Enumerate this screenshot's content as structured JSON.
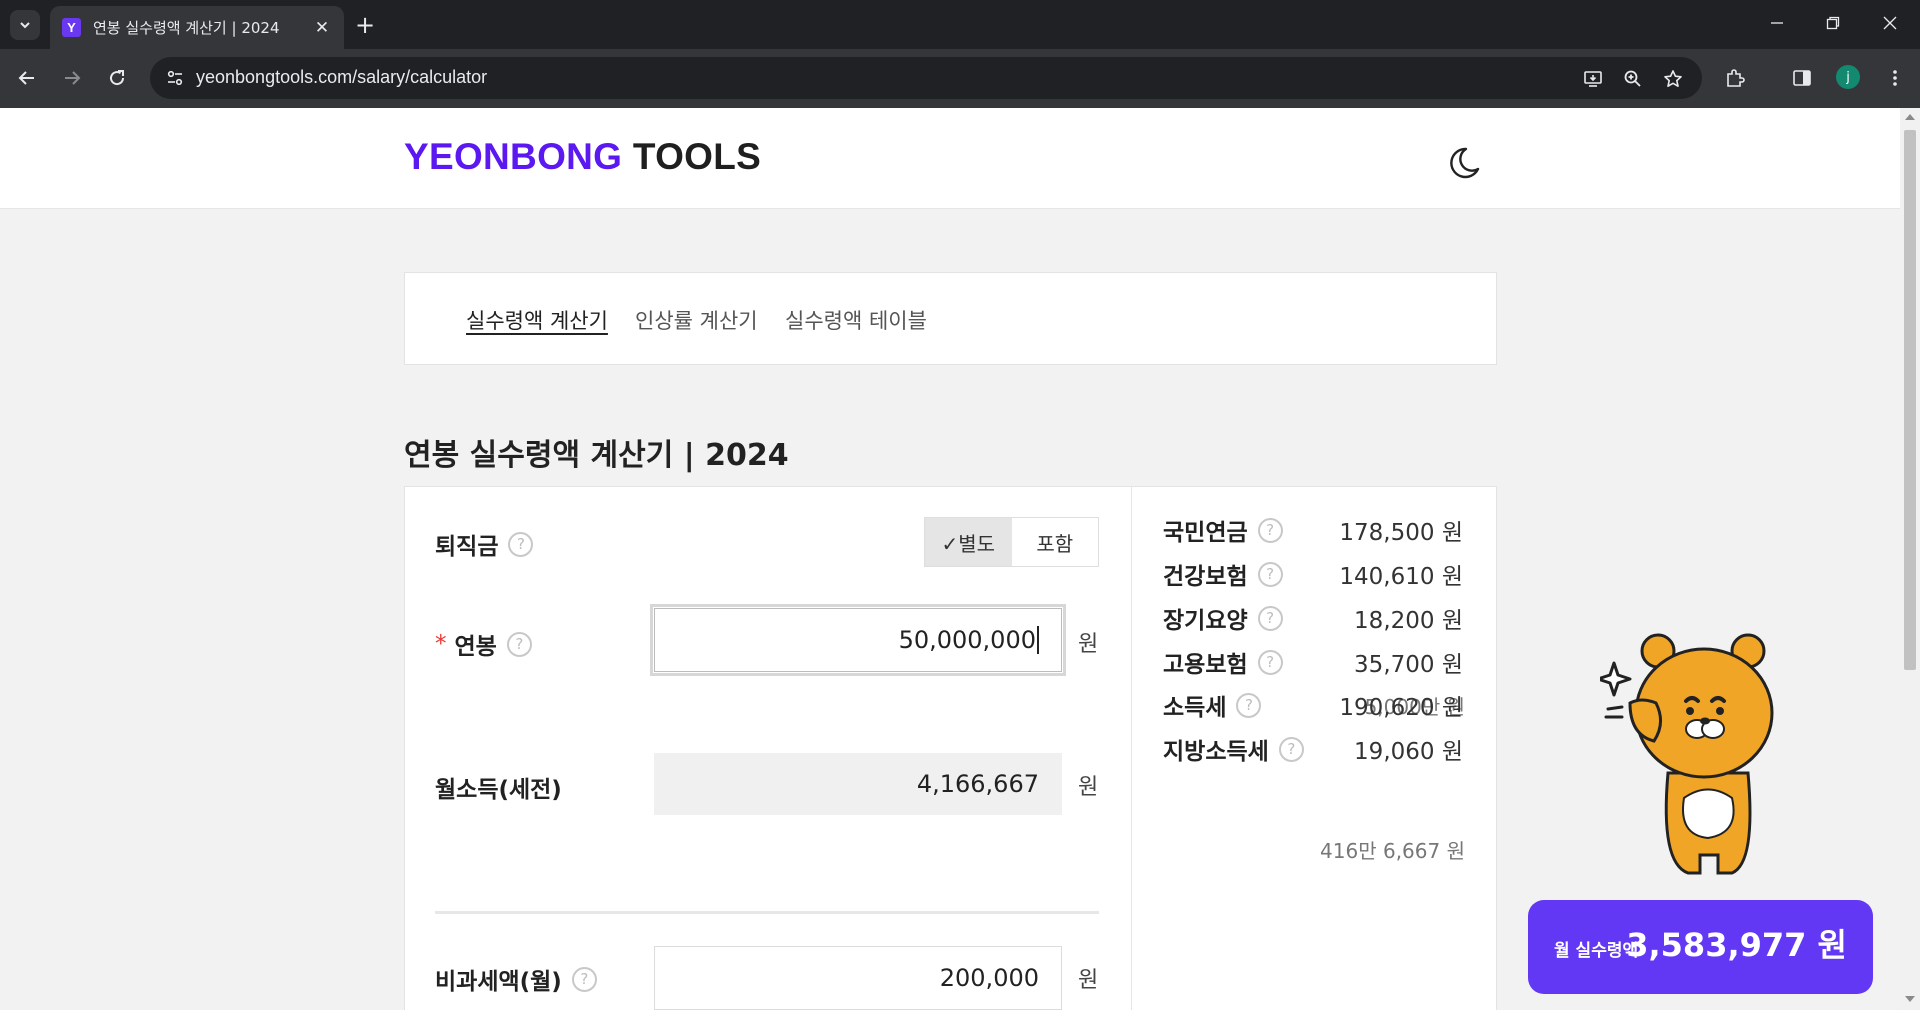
{
  "browser": {
    "tab_title": "연봉 실수령액 계산기 | 2024",
    "favicon_letter": "Y",
    "url": "yeonbongtools.com/salary/calculator",
    "profile_initial": "j"
  },
  "header": {
    "logo_brand": "YEONBONG",
    "logo_suffix": " TOOLS"
  },
  "subnav": {
    "items": [
      {
        "label": "실수령액 계산기",
        "active": true
      },
      {
        "label": "인상률 계산기",
        "active": false
      },
      {
        "label": "실수령액 테이블",
        "active": false
      }
    ]
  },
  "page_title": "연봉 실수령액 계산기 | 2024",
  "form": {
    "severance": {
      "label": "퇴직금",
      "options": [
        "✓별도",
        "포함"
      ],
      "selected": "✓별도"
    },
    "salary": {
      "required_mark": "*",
      "label": "연봉",
      "value": "50,000,000",
      "unit": "원",
      "hint": "5,000만 원"
    },
    "monthly": {
      "label": "월소득(세전)",
      "value": "4,166,667",
      "unit": "원",
      "hint": "416만 6,667 원"
    },
    "nontax": {
      "label": "비과세액(월)",
      "value": "200,000",
      "unit": "원"
    }
  },
  "deductions": [
    {
      "label": "국민연금",
      "value": "178,500 원"
    },
    {
      "label": "건강보험",
      "value": "140,610 원"
    },
    {
      "label": "장기요양",
      "value": "18,200 원"
    },
    {
      "label": "고용보험",
      "value": "35,700 원"
    },
    {
      "label": "소득세",
      "value": "190,620 원"
    },
    {
      "label": "지방소득세",
      "value": "19,060 원"
    }
  ],
  "result": {
    "label": "월 실수령액",
    "value": "3,583,977 원"
  },
  "colors": {
    "brand": "#5b18f0",
    "result_bg": "#6238f5",
    "mascot": "#f0a527"
  }
}
